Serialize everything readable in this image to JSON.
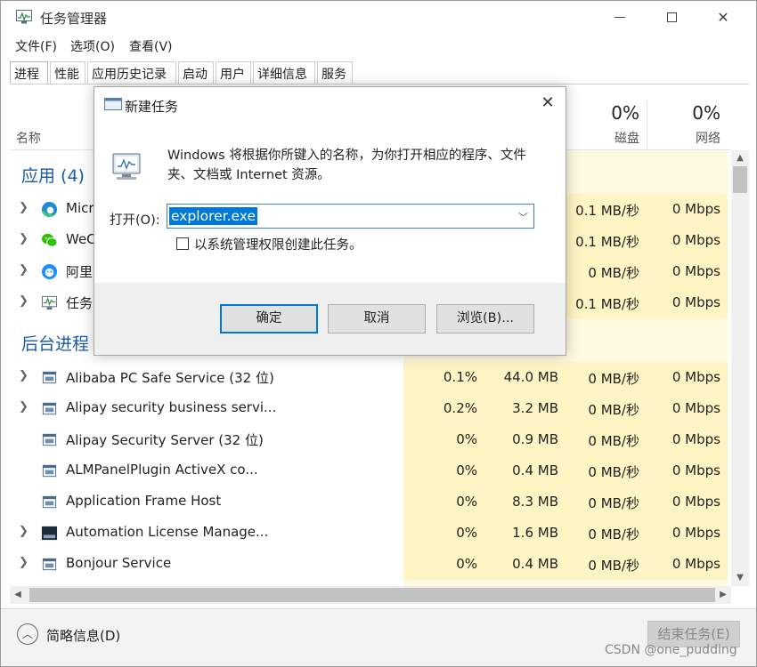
{
  "window": {
    "title": "任务管理器"
  },
  "menu": [
    "文件(F)",
    "选项(O)",
    "查看(V)"
  ],
  "tabs": [
    "进程",
    "性能",
    "应用历史记录",
    "启动",
    "用户",
    "详细信息",
    "服务"
  ],
  "active_tab": "进程",
  "header": {
    "name_label": "名称",
    "disk_pct": "0%",
    "disk_label": "磁盘",
    "net_pct": "0%",
    "net_label": "网络"
  },
  "groups": {
    "apps": "应用 (4)",
    "background": "后台进程"
  },
  "apps": [
    {
      "name": "Micr",
      "icon": "edge-icon",
      "disk": "0.1 MB/秒",
      "net": "0 Mbps"
    },
    {
      "name": "WeC",
      "icon": "wechat-icon",
      "disk": "0.1 MB/秒",
      "net": "0 Mbps"
    },
    {
      "name": "阿里",
      "icon": "aliwangwang-icon",
      "disk": "0 MB/秒",
      "net": "0 Mbps"
    },
    {
      "name": "任务",
      "icon": "task-manager-icon",
      "disk": "0.1 MB/秒",
      "net": "0 Mbps"
    }
  ],
  "processes": [
    {
      "name": "Alibaba PC Safe Service (32 位)",
      "expand": true,
      "icon": "service-icon",
      "cpu": "0.1%",
      "mem": "44.0 MB",
      "disk": "0 MB/秒",
      "net": "0 Mbps"
    },
    {
      "name": "Alipay security business servi...",
      "expand": true,
      "icon": "service-icon",
      "cpu": "0.2%",
      "mem": "3.2 MB",
      "disk": "0 MB/秒",
      "net": "0 Mbps"
    },
    {
      "name": "Alipay Security Server (32 位)",
      "expand": false,
      "icon": "service-icon",
      "cpu": "0%",
      "mem": "0.9 MB",
      "disk": "0 MB/秒",
      "net": "0 Mbps"
    },
    {
      "name": "ALMPanelPlugin ActiveX co...",
      "expand": false,
      "icon": "service-icon",
      "cpu": "0%",
      "mem": "0.4 MB",
      "disk": "0 MB/秒",
      "net": "0 Mbps"
    },
    {
      "name": "Application Frame Host",
      "expand": false,
      "icon": "service-icon",
      "cpu": "0%",
      "mem": "8.3 MB",
      "disk": "0 MB/秒",
      "net": "0 Mbps"
    },
    {
      "name": "Automation License Manage...",
      "expand": true,
      "icon": "license-icon",
      "cpu": "0%",
      "mem": "1.6 MB",
      "disk": "0 MB/秒",
      "net": "0 Mbps"
    },
    {
      "name": "Bonjour Service",
      "expand": true,
      "icon": "service-icon",
      "cpu": "0%",
      "mem": "0.4 MB",
      "disk": "0 MB/秒",
      "net": "0 Mbps"
    }
  ],
  "footer": {
    "fewer_details": "简略信息(D)",
    "end_task": "结束任务(E)",
    "watermark": "CSDN @one_pudding"
  },
  "run_dialog": {
    "title": "新建任务",
    "description": "Windows 将根据你所键入的名称，为你打开相应的程序、文件夹、文档或 Internet 资源。",
    "open_label": "打开(O):",
    "input_value": "explorer.exe",
    "admin_checkbox_label": "以系统管理权限创建此任务。",
    "admin_checked": false,
    "ok": "确定",
    "cancel": "取消",
    "browse": "浏览(B)..."
  },
  "colors": {
    "group_blue": "#1a5aa6",
    "highlight": "#fff4c4",
    "accent": "#0078d7"
  }
}
